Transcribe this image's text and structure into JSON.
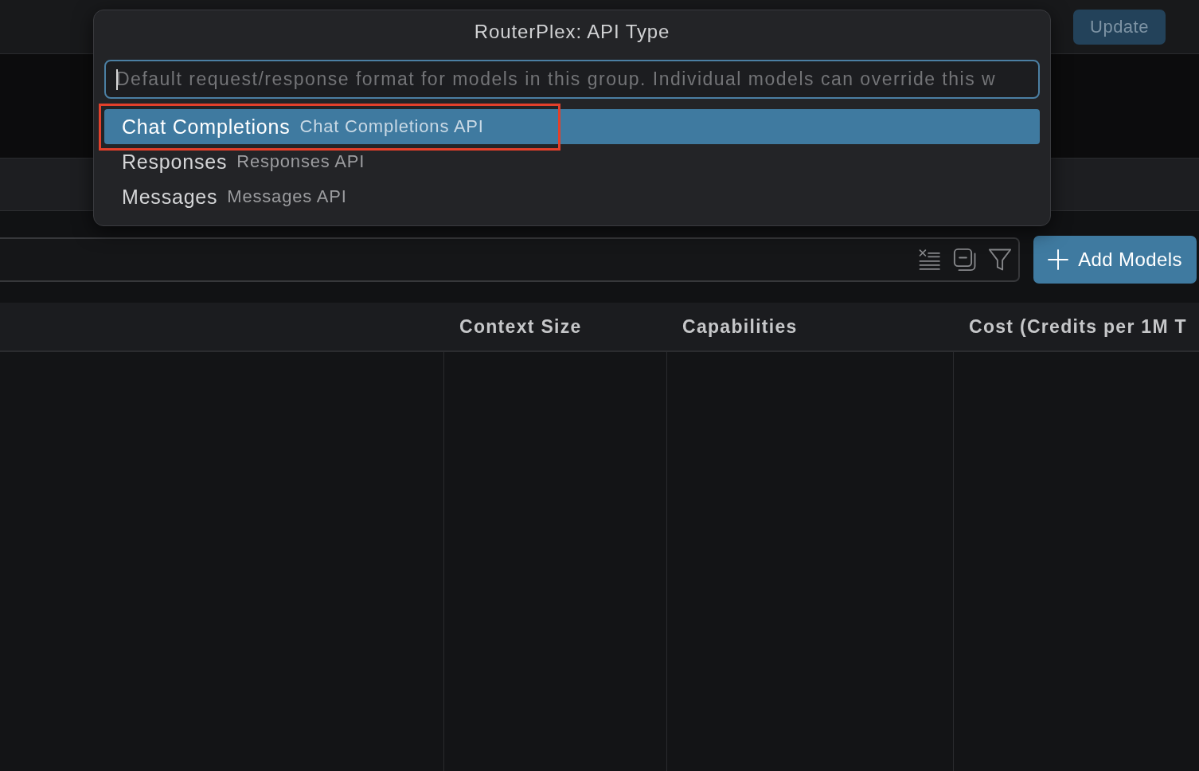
{
  "header": {
    "update_button": "Update"
  },
  "filter_bar": {
    "add_button": "Add Models"
  },
  "table": {
    "columns": [
      {
        "label": "Context Size"
      },
      {
        "label": "Capabilities"
      },
      {
        "label": "Cost (Credits per 1M T"
      }
    ]
  },
  "quick_pick": {
    "title": "RouterPlex: API Type",
    "input": {
      "placeholder": "Default request/response format for models in this group. Individual models can override this w",
      "focused": true
    },
    "options": [
      {
        "label": "Chat Completions",
        "description": "Chat Completions API",
        "selected": true,
        "highlighted": true
      },
      {
        "label": "Responses",
        "description": "Responses API",
        "selected": false,
        "highlighted": false
      },
      {
        "label": "Messages",
        "description": "Messages API",
        "selected": false,
        "highlighted": false
      }
    ]
  }
}
